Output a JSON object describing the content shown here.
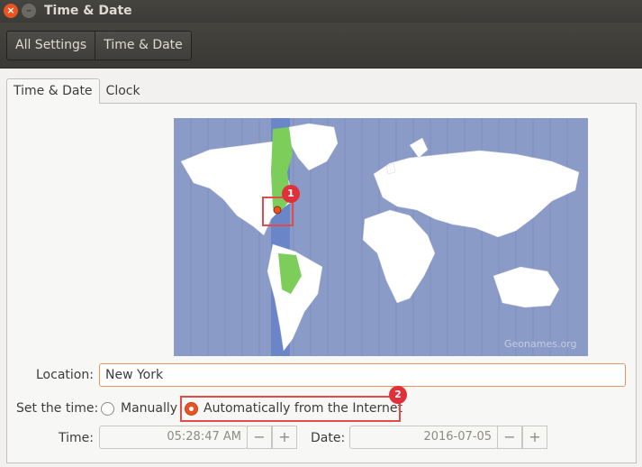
{
  "window": {
    "title": "Time & Date",
    "close_icon": "close-icon",
    "minimize_icon": "minimize-icon"
  },
  "toolbar": {
    "breadcrumbs": [
      "All Settings",
      "Time & Date"
    ]
  },
  "tabs": [
    "Time & Date",
    "Clock"
  ],
  "map": {
    "credit": "Geonames.org",
    "selected_city": "New York"
  },
  "annotations": [
    "1",
    "2"
  ],
  "location": {
    "label": "Location:",
    "value": "New York"
  },
  "set_time": {
    "label": "Set the time:",
    "options": [
      "Manually",
      "Automatically from the Internet"
    ],
    "selected": "Automatically from the Internet"
  },
  "time": {
    "label": "Time:",
    "value": "05:28:47 AM"
  },
  "date": {
    "label": "Date:",
    "value": "2016-07-05"
  },
  "spinner": {
    "minus": "−",
    "plus": "+"
  },
  "colors": {
    "accent": "#e95420",
    "highlight": "#e34b4b",
    "ocean": "#8a9bc8",
    "land": "#ffffff",
    "selected_zone": "#6b86c8",
    "zone_land": "#7ccd5a"
  }
}
